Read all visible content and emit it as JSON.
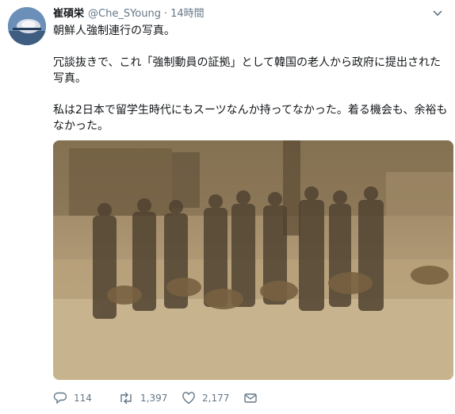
{
  "tweet": {
    "display_name": "崔碩栄",
    "handle": "@Che_SYoung",
    "separator": "·",
    "time": "14時間",
    "paragraphs": [
      "朝鮮人強制連行の写真。",
      "冗談抜きで、これ「強制動員の証拠」として韓国の老人から政府に提出された写真。",
      "私は2日本で留学生時代にもスーツなんか持ってなかった。着る機会も、余裕もなかった。"
    ]
  },
  "actions": {
    "reply_count": "114",
    "retweet_count": "1,397",
    "like_count": "2,177"
  },
  "icons": {
    "avatar": "avatar-image",
    "menu": "chevron-down-icon",
    "reply": "reply-icon",
    "retweet": "retweet-icon",
    "like": "heart-icon",
    "message": "envelope-icon"
  },
  "colors": {
    "text": "#14171a",
    "secondary": "#657786",
    "photo_sepia": "#b9a586"
  }
}
